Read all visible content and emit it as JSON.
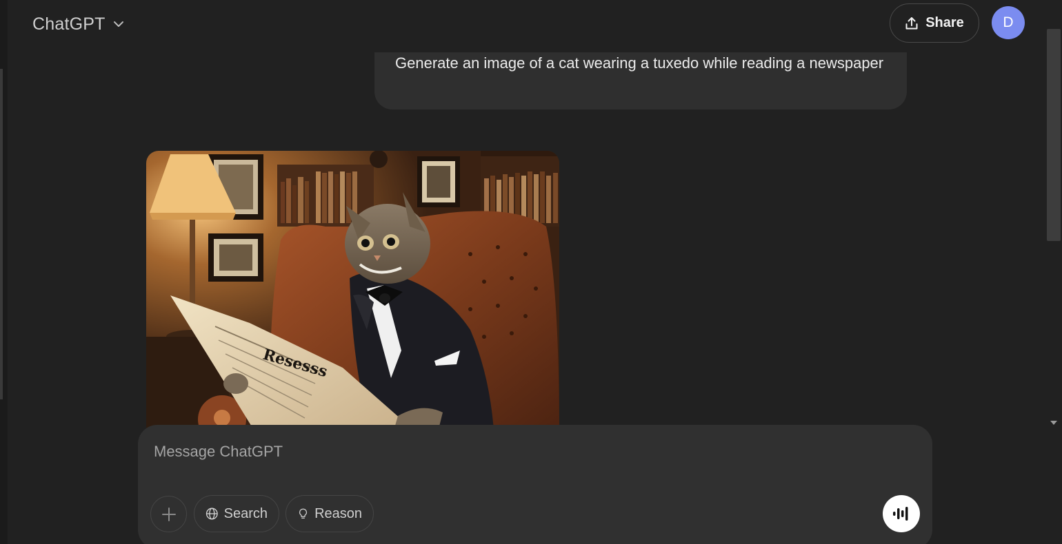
{
  "header": {
    "model_name": "ChatGPT",
    "share_label": "Share",
    "avatar_initial": "D"
  },
  "conversation": {
    "user_message": "Generate an image of a cat wearing a tuxedo while reading a newspaper",
    "generated_image": {
      "newspaper_headline": "Resesss"
    }
  },
  "composer": {
    "placeholder": "Message ChatGPT",
    "search_label": "Search",
    "reason_label": "Reason"
  },
  "icons": {
    "model_chevron": "chevron-down-icon",
    "share": "share-icon",
    "plus": "plus-icon",
    "search": "globe-icon",
    "reason": "lightbulb-icon",
    "voice": "voice-waveform-icon"
  },
  "colors": {
    "background": "#212121",
    "bubble": "#2f2f2f",
    "composer": "#303030",
    "avatar": "#7b8cf0"
  }
}
